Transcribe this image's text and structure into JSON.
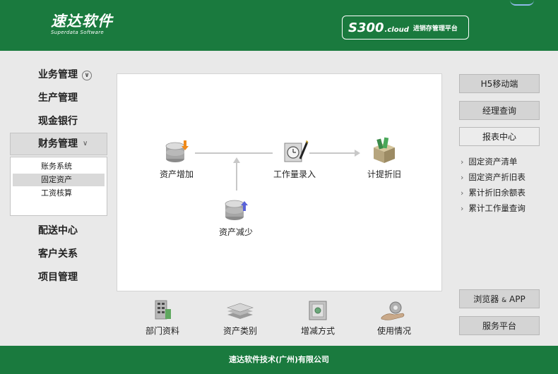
{
  "header": {
    "logo_main": "速达软件",
    "logo_sub": "Superdata Software",
    "product_code": "S300",
    "product_cloud": ".cloud",
    "product_desc": "进销存管理平台"
  },
  "nav": {
    "items": [
      {
        "label": "业务管理"
      },
      {
        "label": "生产管理"
      },
      {
        "label": "现金银行"
      },
      {
        "label": "财务管理"
      },
      {
        "label": "配送中心"
      },
      {
        "label": "客户关系"
      },
      {
        "label": "项目管理"
      }
    ],
    "submenu": [
      {
        "label": "账务系统"
      },
      {
        "label": "固定资产"
      },
      {
        "label": "工资核算"
      }
    ],
    "selected_submenu": "固定资产"
  },
  "flow": {
    "asset_add": "资产增加",
    "work_entry": "工作量录入",
    "depreciation": "计提折旧",
    "asset_reduce": "资产减少"
  },
  "tools": [
    {
      "label": "部门资料",
      "icon": "building-icon"
    },
    {
      "label": "资产类别",
      "icon": "stacked-papers-icon"
    },
    {
      "label": "增减方式",
      "icon": "safe-icon"
    },
    {
      "label": "使用情况",
      "icon": "gear-hand-icon"
    }
  ],
  "right": {
    "h5": "H5移动端",
    "manager": "经理查询",
    "report_center": "报表中心",
    "reports": [
      "固定资产清单",
      "固定资产折旧表",
      "累计折旧余额表",
      "累计工作量查询"
    ],
    "browser_prefix": "浏览器",
    "browser_amp": "&",
    "browser_suffix": "APP",
    "service": "服务平台"
  },
  "footer": {
    "text": "速达软件技术(广州)有限公司"
  },
  "colors": {
    "brand_green": "#1a7a3e",
    "panel_bg": "#e9e9e9"
  }
}
